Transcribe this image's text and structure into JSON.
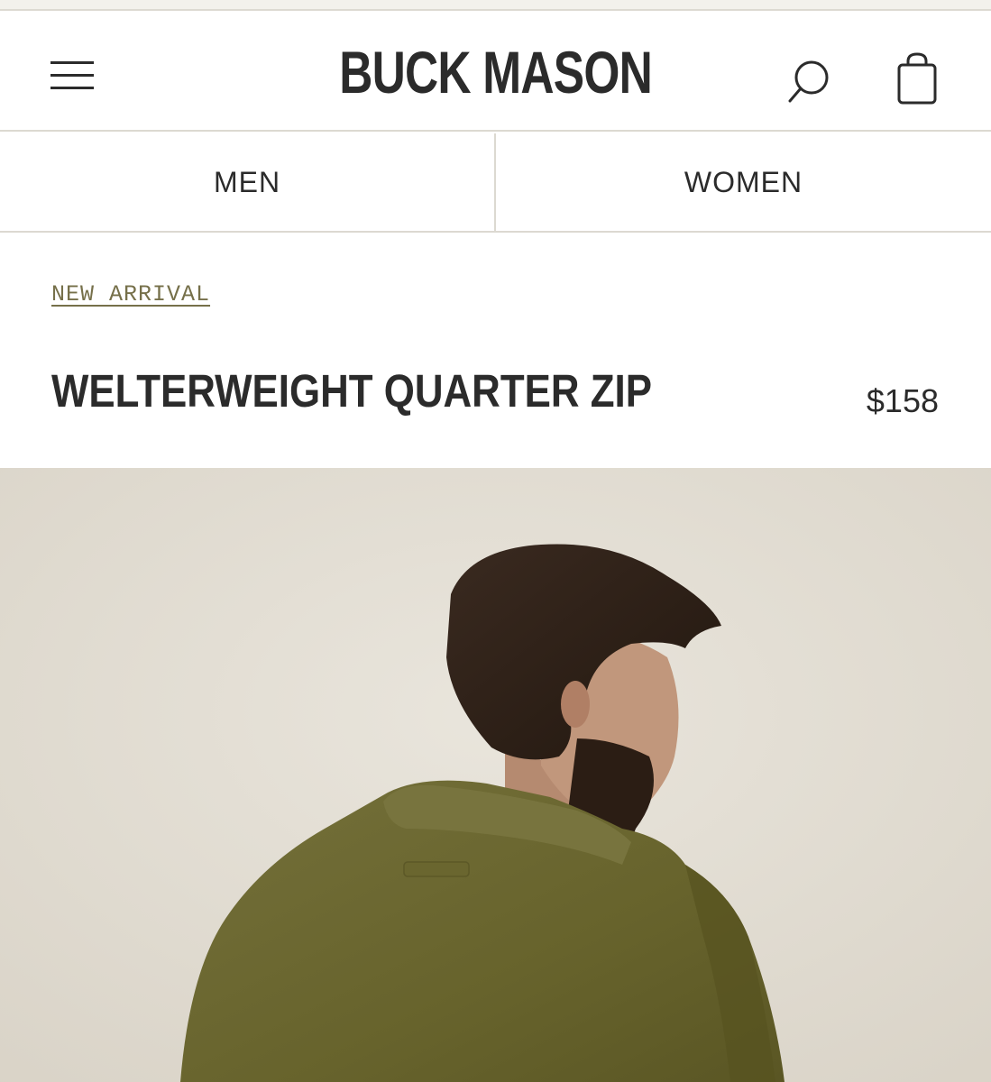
{
  "header": {
    "brand": "BUCK MASON",
    "icons": [
      "menu-icon",
      "search-icon",
      "bag-icon"
    ]
  },
  "nav": {
    "tabs": [
      {
        "label": "MEN"
      },
      {
        "label": "WOMEN"
      }
    ]
  },
  "product": {
    "tag": "NEW ARRIVAL",
    "title": "WELTERWEIGHT QUARTER ZIP",
    "price": "$158"
  },
  "colors": {
    "text": "#2b2b2b",
    "tag": "#76704a",
    "divider": "#dcd9d1",
    "hero_bg": "#e5e0d6",
    "garment": "#6e6a31"
  }
}
